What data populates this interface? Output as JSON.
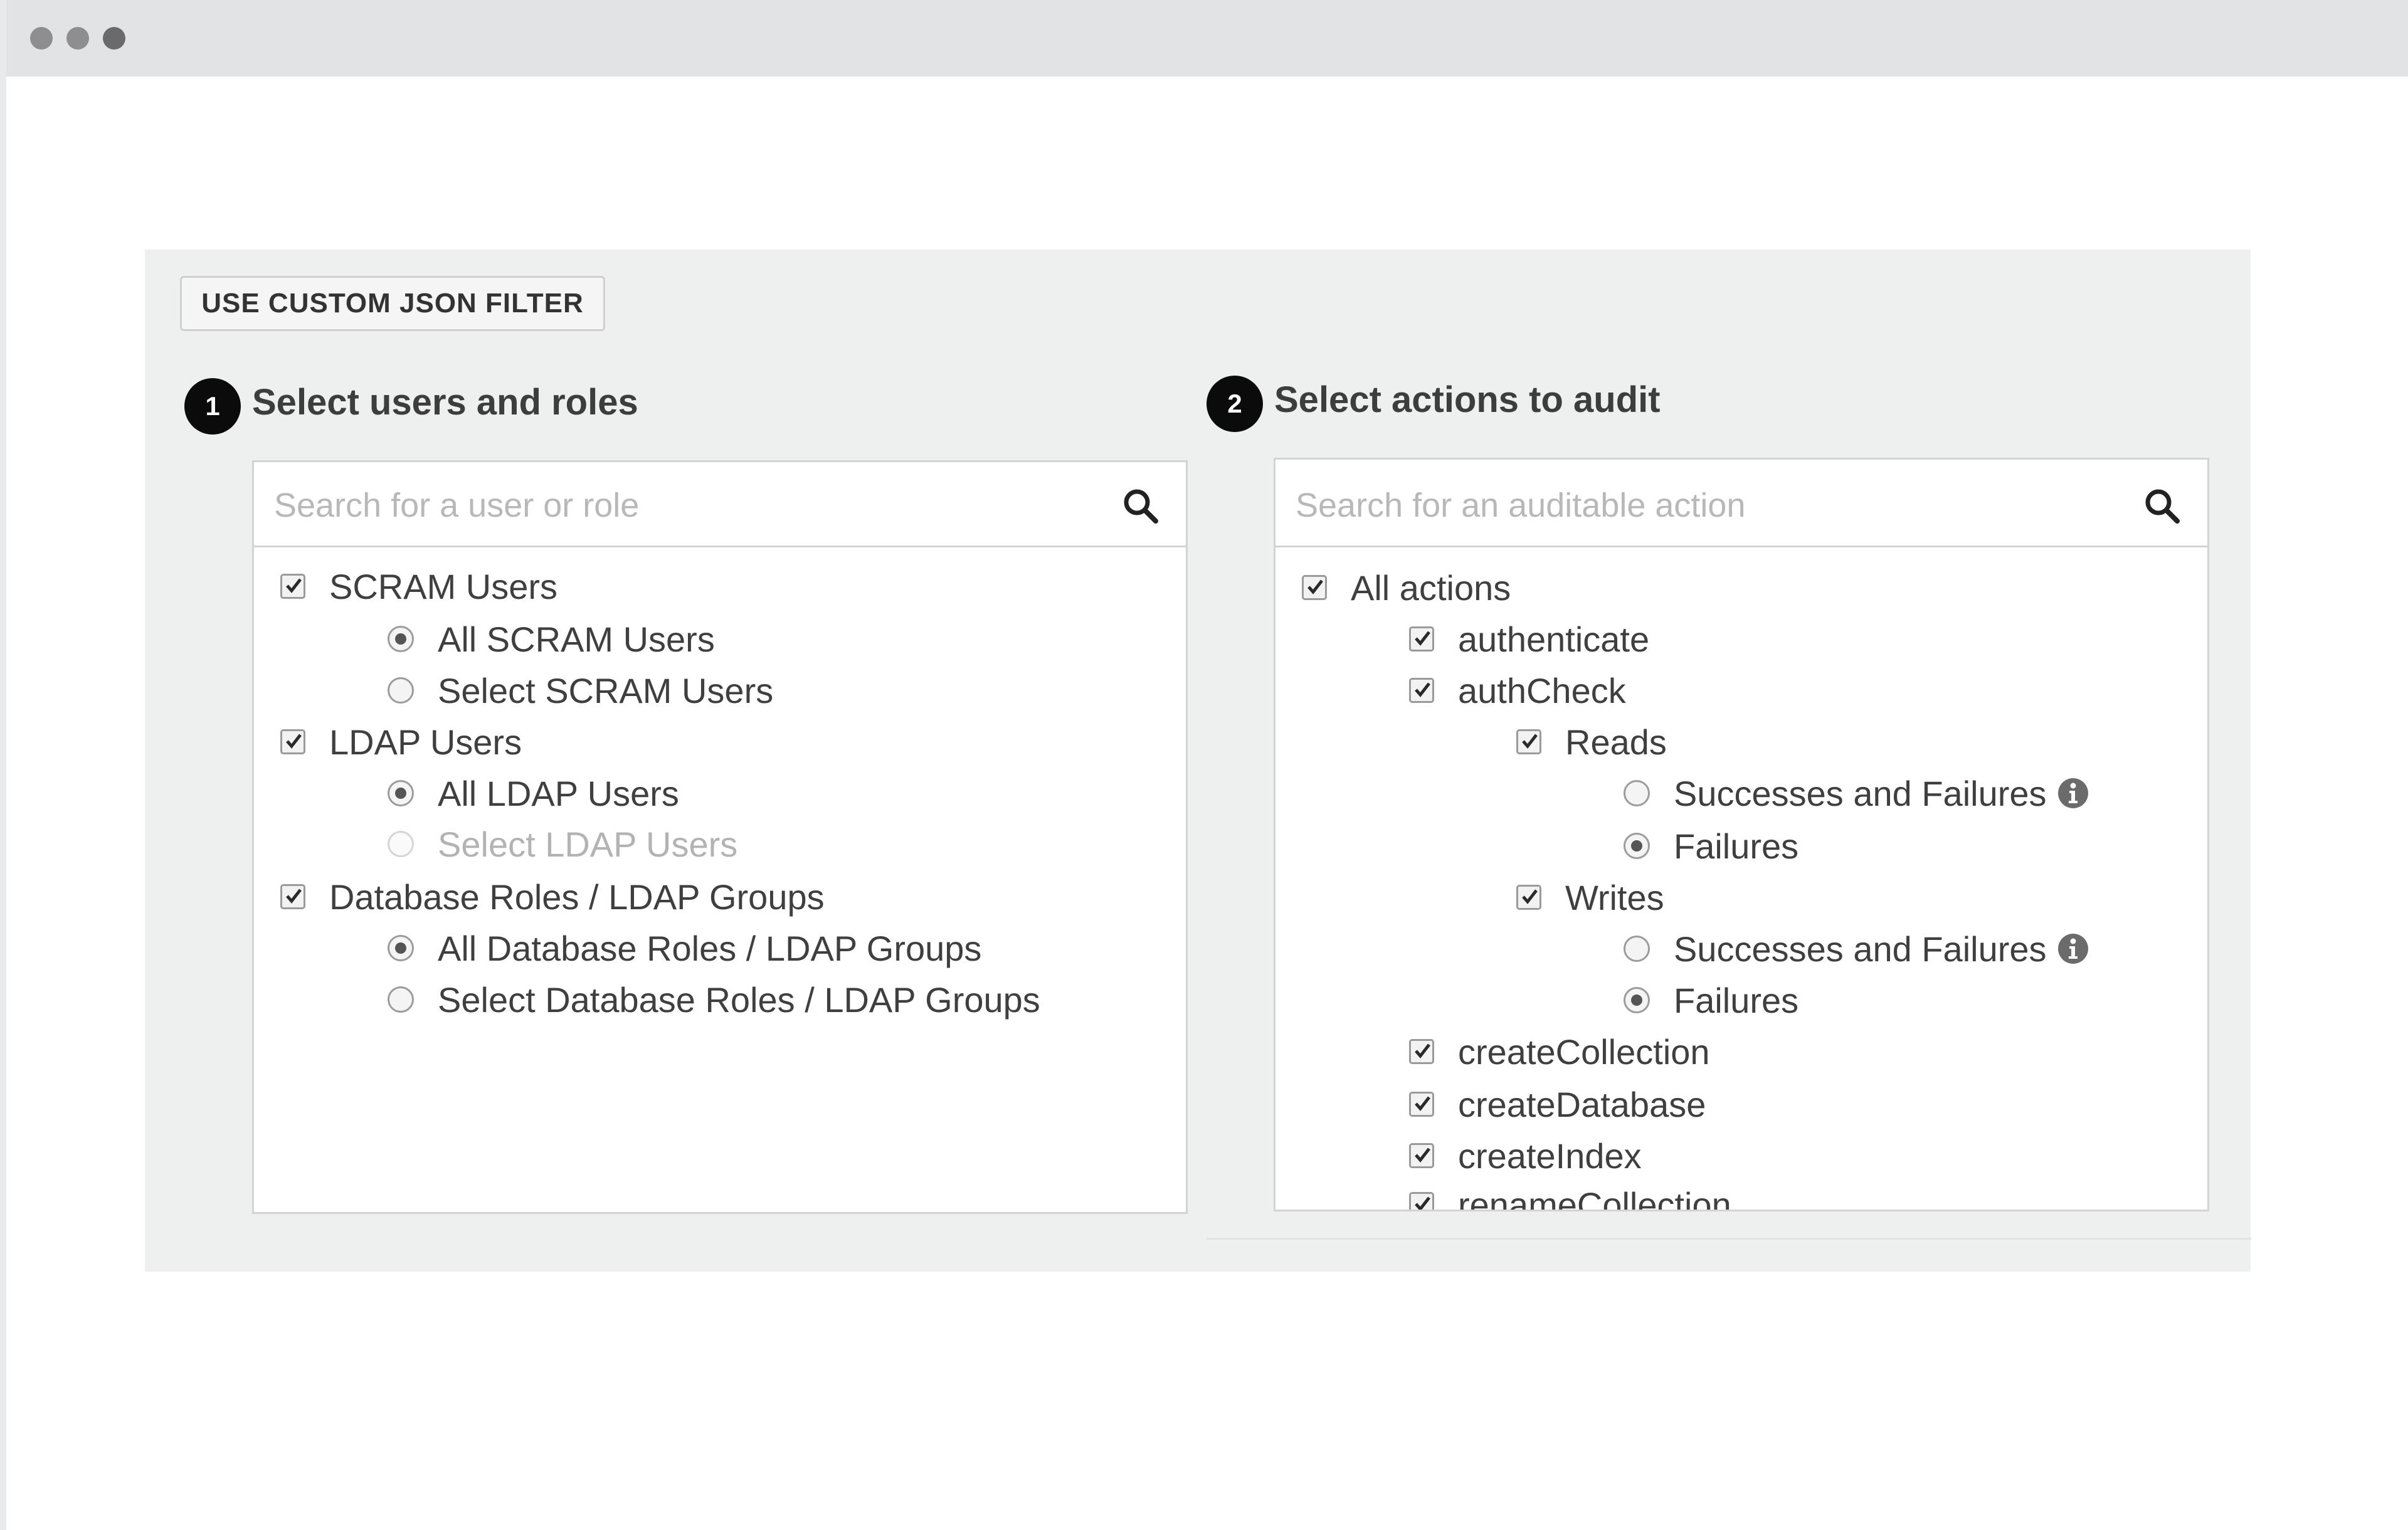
{
  "toolbar": {
    "json_filter_label": "USE CUSTOM JSON FILTER"
  },
  "users_section": {
    "step": "1",
    "title": "Select users and roles",
    "search_placeholder": "Search for a user or role",
    "groups": [
      {
        "label": "SCRAM Users",
        "checked": true,
        "options": [
          {
            "label": "All SCRAM Users",
            "selected": true
          },
          {
            "label": "Select SCRAM Users",
            "selected": false
          }
        ]
      },
      {
        "label": "LDAP Users",
        "checked": true,
        "options": [
          {
            "label": "All LDAP Users",
            "selected": true
          },
          {
            "label": "Select LDAP Users",
            "selected": false,
            "disabled": true
          }
        ]
      },
      {
        "label": "Database Roles / LDAP Groups",
        "checked": true,
        "options": [
          {
            "label": "All Database Roles / LDAP Groups",
            "selected": true
          },
          {
            "label": "Select Database Roles / LDAP Groups",
            "selected": false
          }
        ]
      }
    ]
  },
  "actions_section": {
    "step": "2",
    "title": "Select actions to audit",
    "search_placeholder": "Search for an auditable action",
    "all_actions": "All actions",
    "authenticate": "authenticate",
    "authcheck": "authCheck",
    "reads": {
      "label": "Reads",
      "successes_failures": "Successes and Failures",
      "failures": "Failures",
      "selected": "failures"
    },
    "writes": {
      "label": "Writes",
      "successes_failures": "Successes and Failures",
      "failures": "Failures",
      "selected": "failures"
    },
    "more_actions": [
      "createCollection",
      "createDatabase",
      "createIndex",
      "renameCollection"
    ]
  },
  "icons": {
    "search": "search-icon",
    "checkbox_check": "checkmark-icon",
    "info": "info-icon"
  }
}
